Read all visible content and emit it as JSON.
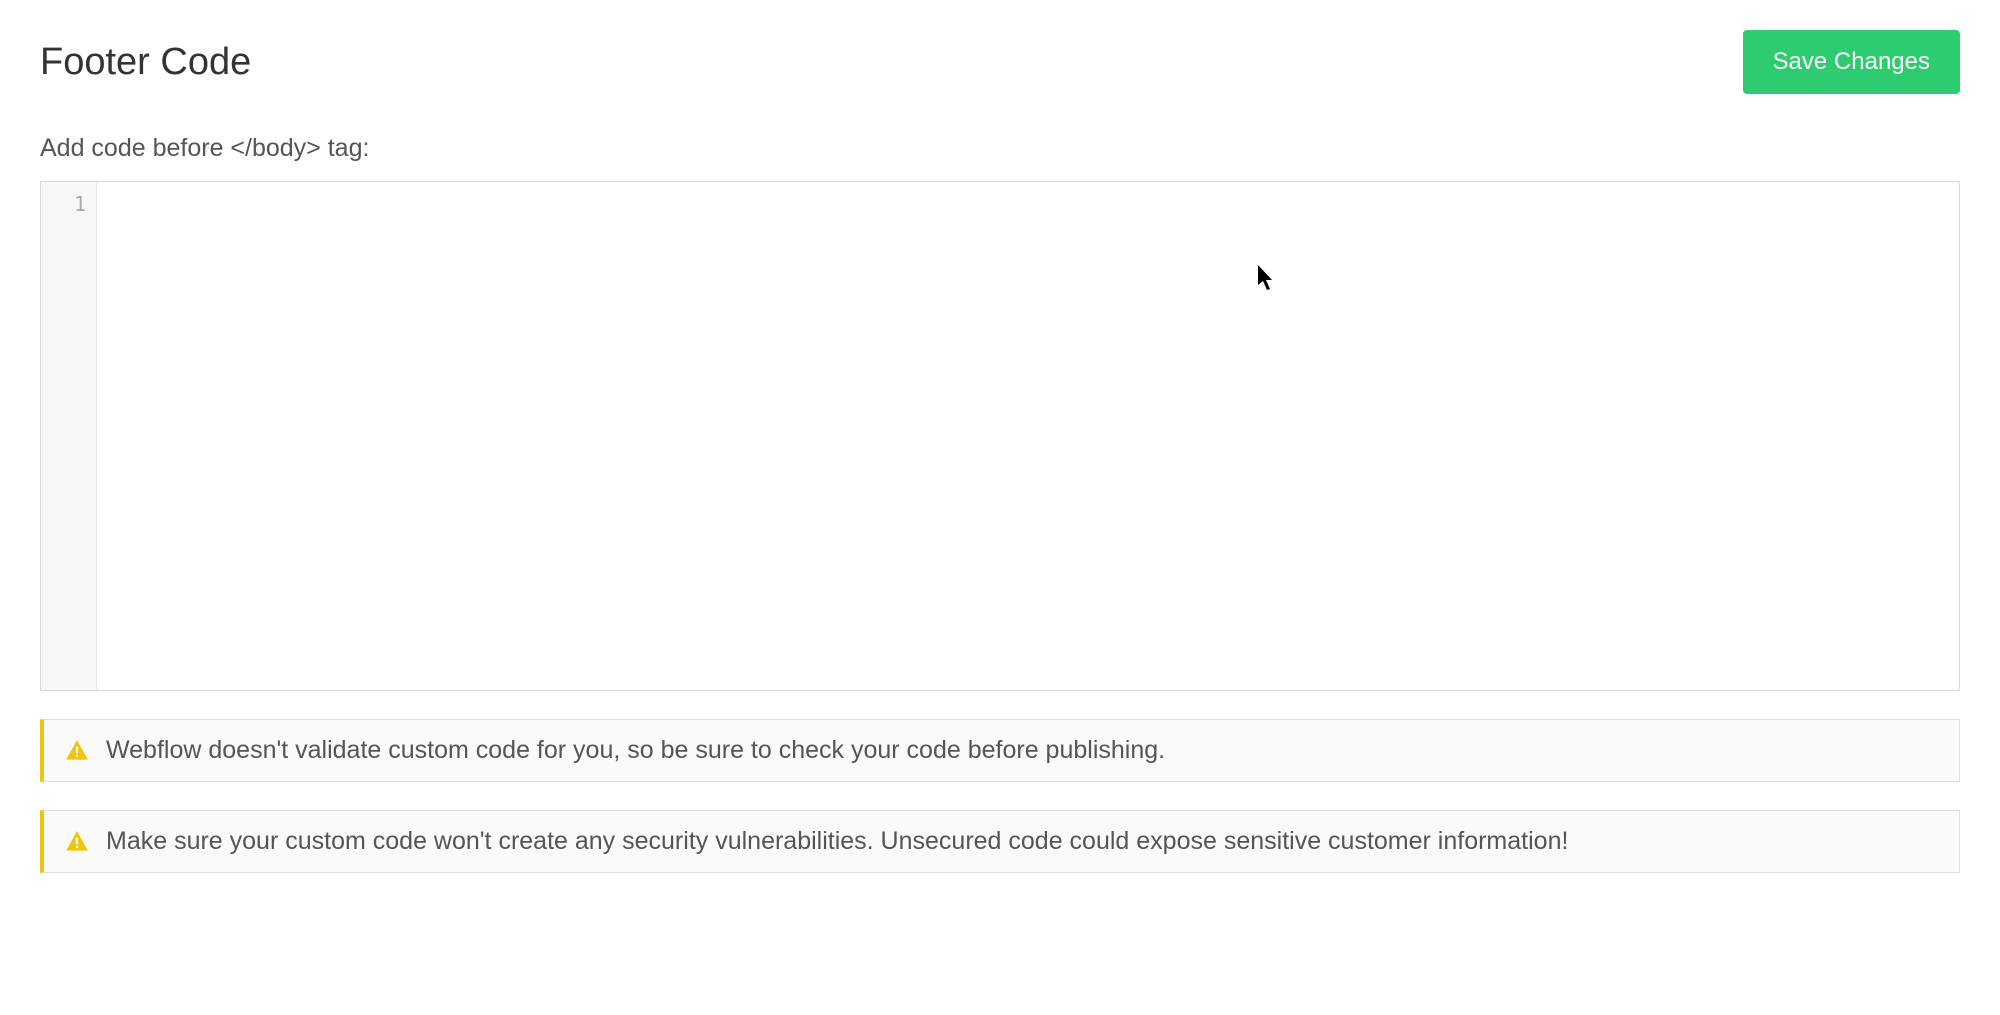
{
  "header": {
    "title": "Footer Code",
    "save_label": "Save Changes"
  },
  "editor": {
    "label": "Add code before </body> tag:",
    "line_number": "1",
    "content": ""
  },
  "alerts": [
    {
      "text": "Webflow doesn't validate custom code for you, so be sure to check your code before publishing."
    },
    {
      "text": "Make sure your custom code won't create any security vulnerabilities. Unsecured code could expose sensitive customer information!"
    }
  ]
}
